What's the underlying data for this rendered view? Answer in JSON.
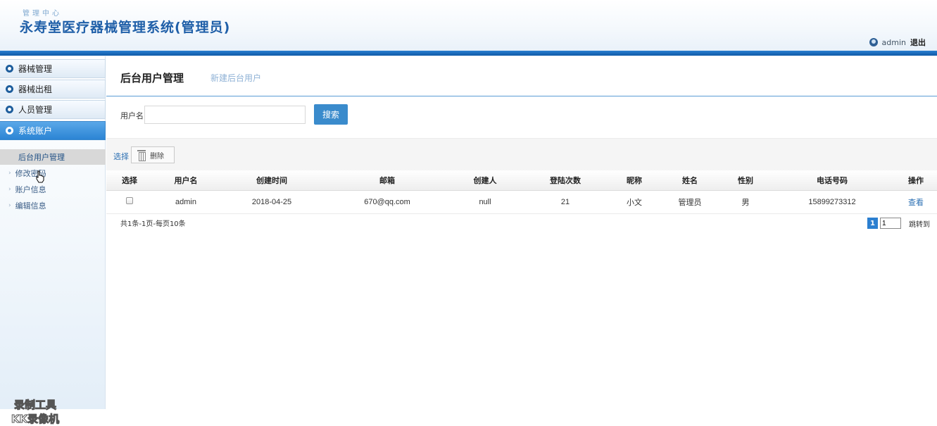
{
  "header": {
    "subtitle": "管理中心",
    "title": "永寿堂医疗器械管理系统(管理员)",
    "username": "admin",
    "logout": "退出"
  },
  "sidebar": {
    "menus": [
      {
        "label": "器械管理",
        "active": false
      },
      {
        "label": "器械出租",
        "active": false
      },
      {
        "label": "人员管理",
        "active": false
      },
      {
        "label": "系统账户",
        "active": true
      }
    ],
    "subitems": [
      {
        "label": "后台用户管理",
        "selected": true
      },
      {
        "label": "修改密码",
        "selected": false
      },
      {
        "label": "账户信息",
        "selected": false
      },
      {
        "label": "编辑信息",
        "selected": false
      }
    ],
    "watermark_line1": "录制工具",
    "watermark_line2": "KK录像机"
  },
  "main": {
    "tab_active": "后台用户管理",
    "tab_new": "新建后台用户",
    "search": {
      "label": "用户名",
      "value": "",
      "button": "搜索"
    },
    "toolbar": {
      "select": "选择",
      "delete": "删除"
    },
    "table": {
      "headers": [
        "选择",
        "用户名",
        "创建时间",
        "邮箱",
        "创建人",
        "登陆次数",
        "昵称",
        "姓名",
        "性别",
        "电话号码",
        "操作"
      ],
      "rows": [
        {
          "username": "admin",
          "created": "2018-04-25",
          "email": "670@qq.com",
          "creator": "null",
          "logins": "21",
          "nickname": "小文",
          "name": "管理员",
          "gender": "男",
          "phone": "15899273312",
          "action": "查看"
        }
      ]
    },
    "pagination": {
      "info": "共1条-1页-每页10条",
      "current": "1",
      "input": "1",
      "jump": "跳转到"
    }
  }
}
